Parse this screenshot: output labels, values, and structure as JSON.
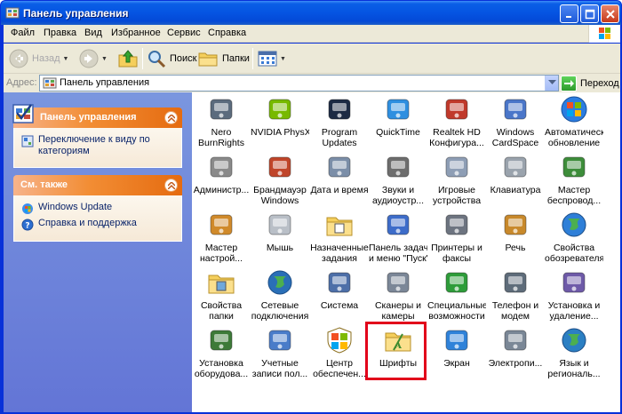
{
  "window": {
    "title": "Панель управления"
  },
  "menu": [
    "Файл",
    "Правка",
    "Вид",
    "Избранное",
    "Сервис",
    "Справка"
  ],
  "toolbar": {
    "back": "Назад",
    "search": "Поиск",
    "folders": "Папки"
  },
  "address": {
    "label": "Адрес:",
    "value": "Панель управления",
    "go": "Переход"
  },
  "sidebar": {
    "control_panel": {
      "title": "Панель управления",
      "link": "Переключение к виду по категориям"
    },
    "see_also": {
      "title": "См. также",
      "links": [
        "Windows Update",
        "Справка и поддержка"
      ]
    }
  },
  "items": [
    {
      "line1": "Nero",
      "line2": "BurnRights",
      "icon": "nero-icon"
    },
    {
      "line1": "NVIDIA PhysX",
      "line2": "",
      "icon": "nvidia-icon"
    },
    {
      "line1": "Program",
      "line2": "Updates",
      "icon": "program-updates-icon"
    },
    {
      "line1": "QuickTime",
      "line2": "",
      "icon": "quicktime-icon"
    },
    {
      "line1": "Realtek HD",
      "line2": "Конфигура...",
      "icon": "realtek-icon"
    },
    {
      "line1": "Windows",
      "line2": "CardSpace",
      "icon": "cardspace-icon"
    },
    {
      "line1": "Автоматическ...",
      "line2": "обновление",
      "icon": "windows-update-icon"
    },
    {
      "line1": "Администр...",
      "line2": "",
      "icon": "admin-tools-icon"
    },
    {
      "line1": "Брандмауэр",
      "line2": "Windows",
      "icon": "firewall-icon"
    },
    {
      "line1": "Дата и время",
      "line2": "",
      "icon": "clock-icon"
    },
    {
      "line1": "Звуки и",
      "line2": "аудиоустр...",
      "icon": "speaker-icon"
    },
    {
      "line1": "Игровые",
      "line2": "устройства",
      "icon": "gamepad-icon"
    },
    {
      "line1": "Клавиатура",
      "line2": "",
      "icon": "keyboard-icon"
    },
    {
      "line1": "Мастер",
      "line2": "беспровод...",
      "icon": "wireless-icon"
    },
    {
      "line1": "Мастер",
      "line2": "настрой...",
      "icon": "network-setup-icon"
    },
    {
      "line1": "Мышь",
      "line2": "",
      "icon": "mouse-icon"
    },
    {
      "line1": "Назначенные",
      "line2": "задания",
      "icon": "scheduled-tasks-icon"
    },
    {
      "line1": "Панель задач",
      "line2": "и меню \"Пуск\"",
      "icon": "taskbar-icon"
    },
    {
      "line1": "Принтеры и",
      "line2": "факсы",
      "icon": "printer-icon"
    },
    {
      "line1": "Речь",
      "line2": "",
      "icon": "speech-icon"
    },
    {
      "line1": "Свойства",
      "line2": "обозревателя",
      "icon": "internet-options-icon"
    },
    {
      "line1": "Свойства",
      "line2": "папки",
      "icon": "folder-options-icon"
    },
    {
      "line1": "Сетевые",
      "line2": "подключения",
      "icon": "network-icon"
    },
    {
      "line1": "Система",
      "line2": "",
      "icon": "system-icon"
    },
    {
      "line1": "Сканеры и",
      "line2": "камеры",
      "icon": "scanner-icon"
    },
    {
      "line1": "Специальные",
      "line2": "возможности",
      "icon": "accessibility-icon"
    },
    {
      "line1": "Телефон и",
      "line2": "модем",
      "icon": "phone-icon"
    },
    {
      "line1": "Установка и",
      "line2": "удаление...",
      "icon": "add-remove-icon"
    },
    {
      "line1": "Установка",
      "line2": "оборудова...",
      "icon": "hardware-icon"
    },
    {
      "line1": "Учетные",
      "line2": "записи пол...",
      "icon": "users-icon"
    },
    {
      "line1": "Центр",
      "line2": "обеспечен...",
      "icon": "security-center-icon"
    },
    {
      "line1": "Шрифты",
      "line2": "",
      "icon": "fonts-folder-icon"
    },
    {
      "line1": "Экран",
      "line2": "",
      "icon": "display-icon"
    },
    {
      "line1": "Электропи...",
      "line2": "",
      "icon": "power-icon"
    },
    {
      "line1": "Язык и",
      "line2": "региональ...",
      "icon": "globe-icon"
    }
  ]
}
